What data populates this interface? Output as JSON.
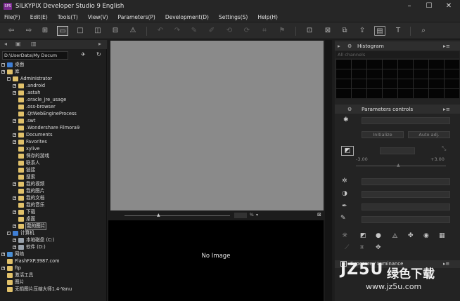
{
  "app": {
    "title": "SILKYPIX Developer Studio 9 English",
    "icon_label": "SPS"
  },
  "window_controls": [
    "minimize-icon",
    "maximize-icon",
    "close-icon"
  ],
  "menu": [
    "File(F)",
    "Edit(E)",
    "Tools(T)",
    "View(V)",
    "Parameters(P)",
    "Development(D)",
    "Settings(S)",
    "Help(H)"
  ],
  "path": {
    "value": "D:\\UserData\\My Docum"
  },
  "tree": [
    {
      "label": "桌面",
      "type": "desktop",
      "exp": "-"
    },
    {
      "label": "库",
      "type": "folder",
      "exp": "+"
    },
    {
      "label": "Administrator",
      "type": "folder",
      "exp": "-"
    },
    {
      "label": ".android",
      "type": "folder",
      "exp": "+"
    },
    {
      "label": ".astah",
      "type": "folder",
      "exp": "+"
    },
    {
      "label": ".oracle_jre_usage",
      "type": "folder",
      "exp": ""
    },
    {
      "label": ".oss-browser",
      "type": "folder",
      "exp": ""
    },
    {
      "label": ".QtWebEngineProcess",
      "type": "folder",
      "exp": ""
    },
    {
      "label": ".swt",
      "type": "folder",
      "exp": "+"
    },
    {
      "label": ".Wondershare Filmora9",
      "type": "folder",
      "exp": ""
    },
    {
      "label": "Documents",
      "type": "folder",
      "exp": "+"
    },
    {
      "label": "Favorites",
      "type": "folder",
      "exp": "+"
    },
    {
      "label": "xylive",
      "type": "folder",
      "exp": ""
    },
    {
      "label": "保存的游戏",
      "type": "folder",
      "exp": ""
    },
    {
      "label": "联系人",
      "type": "folder",
      "exp": ""
    },
    {
      "label": "链接",
      "type": "folder",
      "exp": ""
    },
    {
      "label": "搜索",
      "type": "folder",
      "exp": ""
    },
    {
      "label": "我的视频",
      "type": "folder",
      "exp": "+"
    },
    {
      "label": "我的图片",
      "type": "folder",
      "exp": ""
    },
    {
      "label": "我的文档",
      "type": "folder",
      "exp": "+"
    },
    {
      "label": "我的音乐",
      "type": "folder",
      "exp": ""
    },
    {
      "label": "下载",
      "type": "folder",
      "exp": "+"
    },
    {
      "label": "桌面",
      "type": "folder",
      "exp": ""
    },
    {
      "label": "我的图片",
      "type": "folder",
      "exp": "+",
      "selected": true
    },
    {
      "label": "计算机",
      "type": "computer",
      "exp": "-"
    },
    {
      "label": "本地磁盘 (C:)",
      "type": "drive",
      "exp": "+"
    },
    {
      "label": "软件 (D:)",
      "type": "drive",
      "exp": "+"
    },
    {
      "label": "网络",
      "type": "network",
      "exp": "+"
    },
    {
      "label": "FlashFXP.3987.com",
      "type": "folder",
      "exp": ""
    },
    {
      "label": "ftp",
      "type": "folder",
      "exp": "+"
    },
    {
      "label": "激活工具",
      "type": "folder",
      "exp": ""
    },
    {
      "label": "图片",
      "type": "folder",
      "exp": ""
    },
    {
      "label": "无损图片压缩大师1.4-Yanu",
      "type": "folder",
      "exp": ""
    }
  ],
  "center": {
    "no_image": "No Image",
    "zoom_unit": "%"
  },
  "histogram": {
    "title": "Histogram",
    "channel": "All channels"
  },
  "params": {
    "title": "Parameters controls",
    "initialize": "Initialize",
    "auto_adj": "Auto adj.",
    "min": "-3.00",
    "max": "+3.00"
  },
  "exposure": {
    "title": "Exposure / Luminance"
  },
  "watermark": {
    "line1": "JZ5U",
    "line2": "绿色下载",
    "url": "www.jz5u.com"
  },
  "colors": {
    "preview": "#8a8a8a",
    "folder": "#e1c16a",
    "accent": "#4aa3df"
  }
}
